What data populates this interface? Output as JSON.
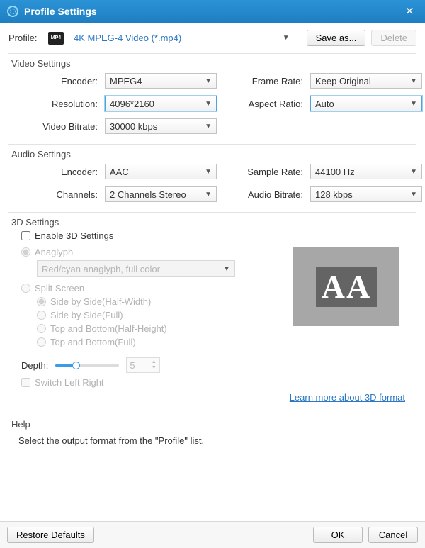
{
  "title": "Profile Settings",
  "profile": {
    "label": "Profile:",
    "value": "4K MPEG-4 Video (*.mp4)",
    "save_as": "Save as...",
    "delete": "Delete"
  },
  "video": {
    "header": "Video Settings",
    "encoder_label": "Encoder:",
    "encoder": "MPEG4",
    "frame_rate_label": "Frame Rate:",
    "frame_rate": "Keep Original",
    "resolution_label": "Resolution:",
    "resolution": "4096*2160",
    "aspect_label": "Aspect Ratio:",
    "aspect": "Auto",
    "bitrate_label": "Video Bitrate:",
    "bitrate": "30000 kbps"
  },
  "audio": {
    "header": "Audio Settings",
    "encoder_label": "Encoder:",
    "encoder": "AAC",
    "sample_label": "Sample Rate:",
    "sample": "44100 Hz",
    "channels_label": "Channels:",
    "channels": "2 Channels Stereo",
    "bitrate_label": "Audio Bitrate:",
    "bitrate": "128 kbps"
  },
  "d3": {
    "header": "3D Settings",
    "enable": "Enable 3D Settings",
    "anaglyph": "Anaglyph",
    "anaglyph_mode": "Red/cyan anaglyph, full color",
    "split": "Split Screen",
    "sbs_half": "Side by Side(Half-Width)",
    "sbs_full": "Side by Side(Full)",
    "tab_half": "Top and Bottom(Half-Height)",
    "tab_full": "Top and Bottom(Full)",
    "depth_label": "Depth:",
    "depth_value": "5",
    "switch_lr": "Switch Left Right",
    "preview_text": "AA",
    "learn_more": "Learn more about 3D format"
  },
  "help": {
    "header": "Help",
    "text": "Select the output format from the \"Profile\" list."
  },
  "footer": {
    "restore": "Restore Defaults",
    "ok": "OK",
    "cancel": "Cancel"
  }
}
